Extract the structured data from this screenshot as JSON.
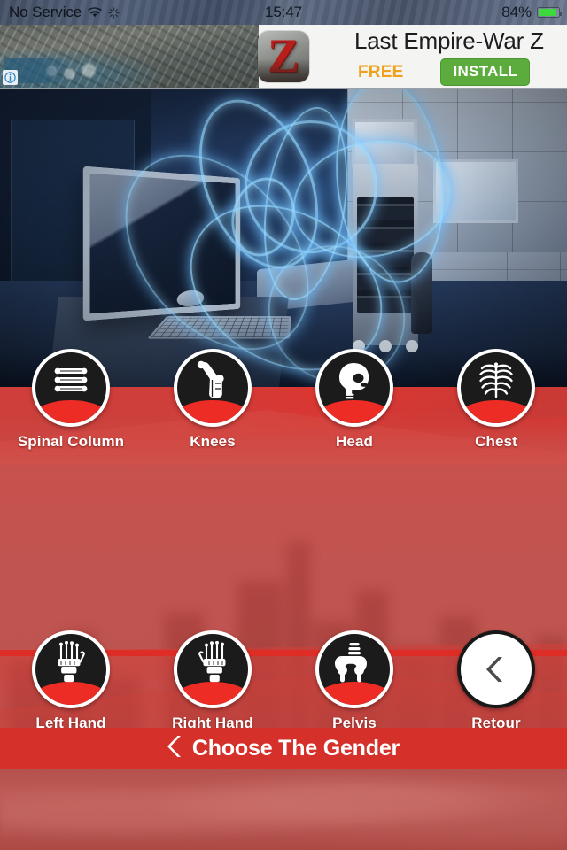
{
  "status_bar": {
    "carrier": "No Service",
    "wifi_icon": "wifi-icon",
    "location_icon": "location-services-icon",
    "time": "15:47",
    "battery_percent": "84%",
    "battery_level": 84
  },
  "ad_banner": {
    "adchoices_icon": "info-icon",
    "app_icon_letter": "Z",
    "title": "Last Empire-War Z",
    "price_label": "FREE",
    "install_label": "INSTALL"
  },
  "hero": {
    "alt": "operating room with medical equipment and blue light swirls"
  },
  "body_parts_row1": [
    {
      "label": "Spinal Column",
      "icon": "spine-icon"
    },
    {
      "label": "Knees",
      "icon": "knee-joint-icon"
    },
    {
      "label": "Head",
      "icon": "skull-icon"
    },
    {
      "label": "Chest",
      "icon": "ribcage-icon"
    }
  ],
  "body_parts_row2": [
    {
      "label": "Left Hand",
      "icon": "left-hand-bones-icon"
    },
    {
      "label": "Right Hand",
      "icon": "right-hand-bones-icon"
    },
    {
      "label": "Pelvis",
      "icon": "pelvis-icon"
    },
    {
      "label": "Retour",
      "icon": "chevron-left-icon"
    }
  ],
  "footer": {
    "chevron_icon": "chevron-left-icon",
    "label": "Choose The Gender"
  },
  "colors": {
    "primary_red": "#D5302A",
    "body_red": "#C05450",
    "accent_line_red": "#E02B24",
    "circle_dark": "#1B1B1B",
    "circle_red": "#EE2C26",
    "install_green": "#5CAB3D",
    "free_orange": "#F0A11A",
    "battery_green": "#3CD83C",
    "white": "#FFFFFF"
  }
}
